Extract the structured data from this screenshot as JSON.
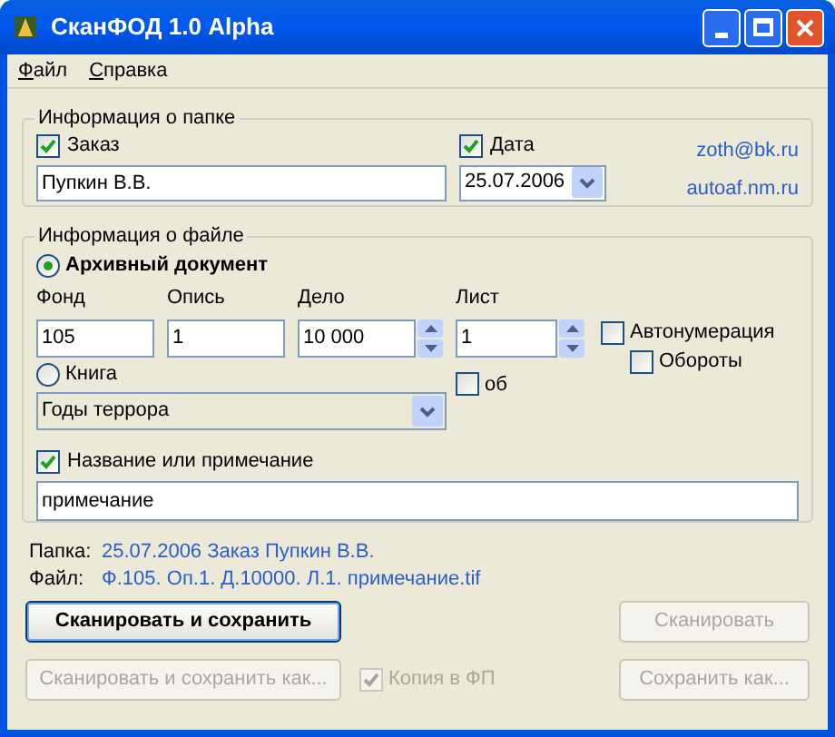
{
  "window": {
    "title": "СканФОД 1.0 Alpha"
  },
  "menu": [
    {
      "label": "Файл"
    },
    {
      "label": "Справка"
    }
  ],
  "folder_info": {
    "title": "Информация о папке",
    "order": {
      "label": "Заказ",
      "checked": true,
      "value": "Пупкин В.В."
    },
    "date": {
      "label": "Дата",
      "checked": true,
      "value": "25.07.2006"
    },
    "links": [
      "zoth@bk.ru",
      "autoaf.nm.ru"
    ]
  },
  "file_info": {
    "title": "Информация о файле",
    "archive": {
      "label": "Архивный документ",
      "selected": true
    },
    "fields": [
      {
        "label": "Фонд",
        "value": "105",
        "kind": "text"
      },
      {
        "label": "Опись",
        "value": "1",
        "kind": "text"
      },
      {
        "label": "Дело",
        "value": "10 000",
        "kind": "spin"
      },
      {
        "label": "Лист",
        "value": "1",
        "kind": "spin"
      }
    ],
    "autonumbering": {
      "label": "Автонумерация",
      "checked": false
    },
    "turnovers": {
      "label": "Обороты",
      "checked": false
    },
    "book": {
      "label": "Книга",
      "selected": false,
      "value": "Годы террора"
    },
    "reverse": {
      "label": "об",
      "checked": false
    },
    "note": {
      "label": "Название или примечание",
      "checked": true,
      "value": "примечание"
    }
  },
  "summary": [
    {
      "label": "Папка:",
      "value": "25.07.2006 Заказ Пупкин В.В."
    },
    {
      "label": "Файл:",
      "value": "Ф.105. Оп.1. Д.10000. Л.1. примечание.tif"
    }
  ],
  "buttons": [
    {
      "label": "Сканировать и сохранить",
      "disabled": false,
      "default": true
    },
    {
      "label": "Сканировать",
      "disabled": true,
      "default": false
    },
    {
      "label": "Сканировать и сохранить как...",
      "disabled": true,
      "default": false
    },
    {
      "label": "Сохранить как...",
      "disabled": true,
      "default": false
    }
  ],
  "copy": {
    "label": "Копия в ФП",
    "checked": true,
    "disabled": true
  }
}
